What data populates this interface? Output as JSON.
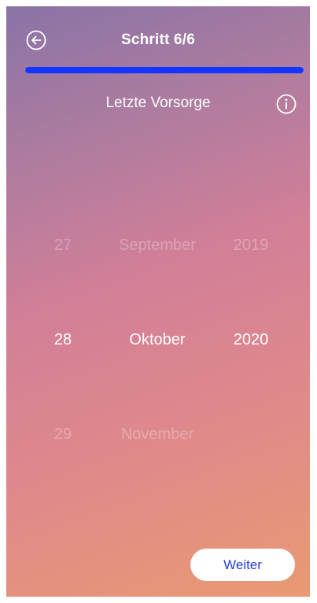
{
  "header": {
    "title": "Schritt 6/6",
    "progress_fraction": 1.0,
    "progress_color": "#1434ff"
  },
  "icons": {
    "back": "arrow-left-circle-icon",
    "info": "info-circle-icon"
  },
  "subtitle": "Letzte Vorsorge",
  "picker": {
    "previous": {
      "day": "27",
      "month": "September",
      "year": "2019"
    },
    "selected": {
      "day": "28",
      "month": "Oktober",
      "year": "2020"
    },
    "next": {
      "day": "29",
      "month": "November",
      "year": ""
    }
  },
  "actions": {
    "continue_label": "Weiter",
    "continue_text_color": "#2b3fd1"
  },
  "colors": {
    "gradient": [
      "#8a73a6",
      "#d27f98",
      "#e99a72"
    ]
  }
}
